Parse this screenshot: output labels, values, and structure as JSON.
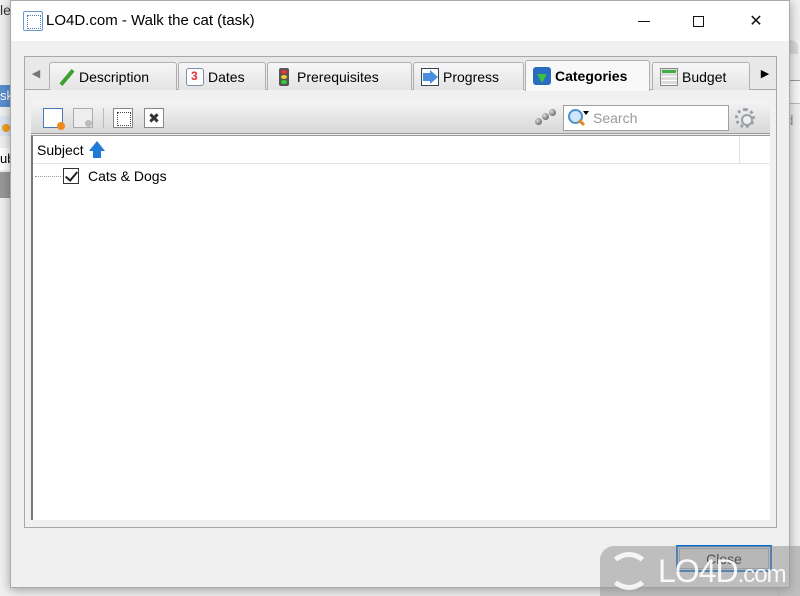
{
  "window": {
    "title": "LO4D.com - Walk the cat (task)",
    "controls": {
      "minimize": "minimize",
      "maximize": "maximize",
      "close": "close"
    }
  },
  "background": {
    "left_snippets": [
      "le",
      "sk",
      "ub"
    ],
    "right_snippet": "rd"
  },
  "tabs": [
    {
      "label": "Description",
      "icon": "pencil-icon",
      "active": false
    },
    {
      "label": "Dates",
      "icon": "calendar-icon",
      "active": false
    },
    {
      "label": "Prerequisites",
      "icon": "traffic-light-icon",
      "active": false
    },
    {
      "label": "Progress",
      "icon": "arrow-right-icon",
      "active": false
    },
    {
      "label": "Categories",
      "icon": "folder-icon",
      "active": true
    },
    {
      "label": "Budget",
      "icon": "calculator-icon",
      "active": false
    }
  ],
  "tab_scroll": {
    "left": "◀",
    "right": "▶"
  },
  "toolbar": {
    "buttons": [
      "new-category",
      "new-subcategory",
      "expand-all",
      "delete"
    ],
    "delete_glyph": "✖",
    "search_placeholder": "Search",
    "search_value": ""
  },
  "tree": {
    "columns": [
      {
        "label": "Subject",
        "sort": "ascending"
      }
    ],
    "rows": [
      {
        "label": "Cats & Dogs",
        "checked": true
      }
    ]
  },
  "footer": {
    "close_label": "Close"
  },
  "watermark": {
    "brand": "LO4D",
    "suffix": ".com"
  }
}
